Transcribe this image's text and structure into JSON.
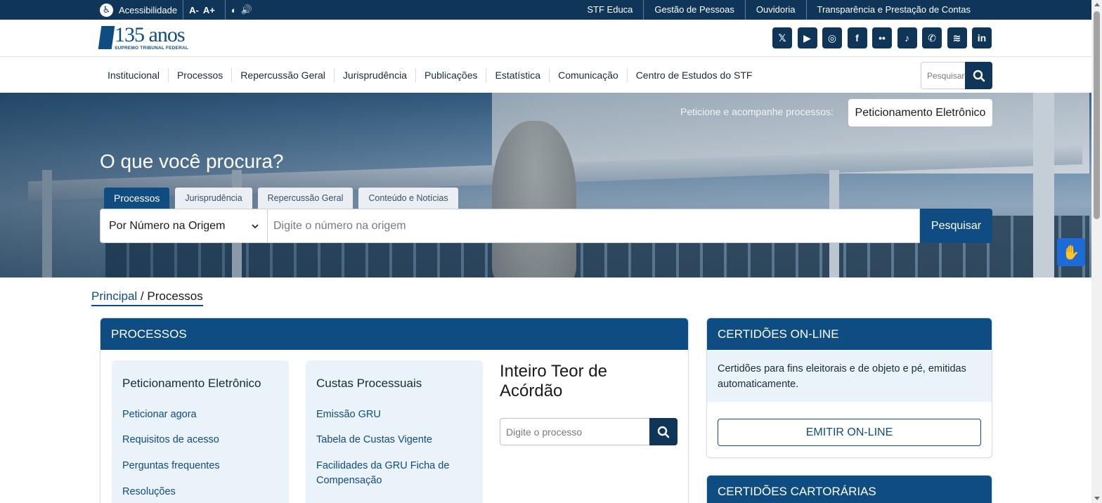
{
  "topbar": {
    "accessibility_label": "Acessibilidade",
    "font_decrease": "A-",
    "font_increase": "A+",
    "links": [
      "STF Educa",
      "Gestão de Pessoas",
      "Ouvidoria",
      "Transparência e Prestação de Contas"
    ]
  },
  "header": {
    "logo_number": "135 anos",
    "logo_sub": "SUPREMO TRIBUNAL FEDERAL",
    "socials": [
      {
        "name": "x-icon",
        "glyph": "𝕏"
      },
      {
        "name": "youtube-icon",
        "glyph": "▶"
      },
      {
        "name": "instagram-icon",
        "glyph": "◎"
      },
      {
        "name": "facebook-icon",
        "glyph": "f"
      },
      {
        "name": "flickr-icon",
        "glyph": "••"
      },
      {
        "name": "tiktok-icon",
        "glyph": "♪"
      },
      {
        "name": "whatsapp-icon",
        "glyph": "✆"
      },
      {
        "name": "spotify-icon",
        "glyph": "≋"
      },
      {
        "name": "linkedin-icon",
        "glyph": "in"
      }
    ]
  },
  "nav": {
    "items": [
      "Institucional",
      "Processos",
      "Repercussão Geral",
      "Jurisprudência",
      "Publicações",
      "Estatística",
      "Comunicação",
      "Centro de Estudos do STF"
    ],
    "search_placeholder": "Pesquisar"
  },
  "hero": {
    "peticione_text": "Peticione e acompanhe processos:",
    "peticione_button": "Peticionamento Eletrônico",
    "title": "O que você procura?",
    "tabs": [
      "Processos",
      "Jurisprudência",
      "Repercussão Geral",
      "Conteúdo e Notícias"
    ],
    "select_value": "Por Número na Origem",
    "input_placeholder": "Digite o número na origem",
    "search_button": "Pesquisar"
  },
  "breadcrumb": {
    "home": "Principal",
    "separator": " / ",
    "current": "Processos"
  },
  "processos": {
    "title": "PROCESSOS",
    "peticionamento": {
      "title": "Peticionamento Eletrônico",
      "links": [
        "Peticionar agora",
        "Requisitos de acesso",
        "Perguntas frequentes",
        "Resoluções"
      ]
    },
    "custas": {
      "title": "Custas Processuais",
      "links": [
        "Emissão GRU",
        "Tabela de Custas Vigente",
        "Facilidades da GRU Ficha de Compensação"
      ]
    },
    "teor": {
      "title": "Inteiro Teor de Acórdão",
      "placeholder": "Digite o processo"
    }
  },
  "certidoes": {
    "title": "CERTIDÕES ON-LINE",
    "description": "Certidões para fins eleitorais e de objeto e pé, emitidas automaticamente.",
    "button": "EMITIR ON-LINE"
  },
  "cartorarias": {
    "title": "CERTIDÕES CARTORÁRIAS"
  },
  "colors": {
    "primary": "#0f4c81",
    "dark": "#0f3559",
    "light_bg": "#eaf2fa",
    "vlibras": "#1c6bd6"
  }
}
